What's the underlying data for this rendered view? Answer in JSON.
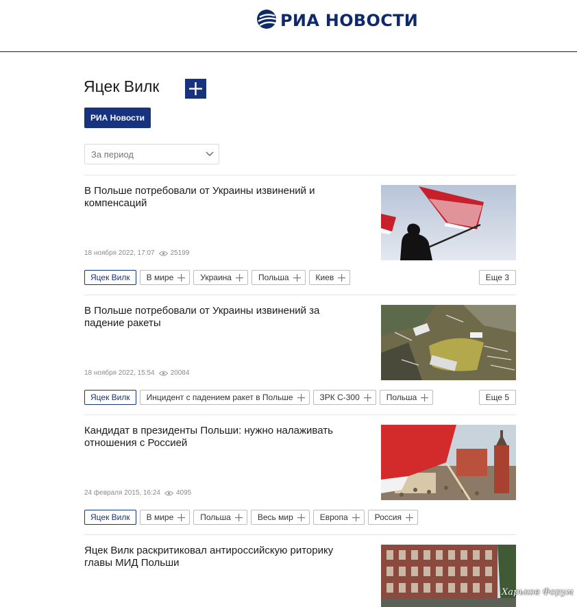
{
  "header": {
    "logo_text": "РИА НОВОСТИ",
    "logo_icon": "ria-globe-icon"
  },
  "page": {
    "title": "Яцек Вилк",
    "add_button": "plus-icon"
  },
  "source_badge": "РИА Новости",
  "period_select": {
    "selected": "За период"
  },
  "articles": [
    {
      "title": "В Польше потребовали от Украины извинений и компенсаций",
      "date": "18 ноября 2022, 17:07",
      "views": "25199",
      "tags": [
        "Яцек Вилк",
        "В мире",
        "Украина",
        "Польша",
        "Киев"
      ],
      "more": "Еще 3"
    },
    {
      "title": "В Польше потребовали от Украины извинений за падение ракеты",
      "date": "18 ноября 2022, 15:54",
      "views": "20084",
      "tags": [
        "Яцек Вилк",
        "Инцидент с падением ракет в Польше",
        "ЗРК С-300",
        "Польша"
      ],
      "more": "Еще 5"
    },
    {
      "title": "Кандидат в президенты Польши: нужно налаживать отношения с Россией",
      "date": "24 февраля 2015, 16:24",
      "views": "4095",
      "tags": [
        "Яцек Вилк",
        "В мире",
        "Польша",
        "Весь мир",
        "Европа",
        "Россия"
      ],
      "more": ""
    },
    {
      "title": "Яцек Вилк раскритиковал антироссийскую риторику главы МИД Польши",
      "date": "",
      "views": "",
      "tags": [],
      "more": ""
    }
  ],
  "watermark": "Харьков Форум",
  "colors": {
    "brand": "#17327e",
    "logo_text": "#0f2a6b",
    "divider": "#e4e4e4",
    "meta": "#8a8a8a"
  }
}
